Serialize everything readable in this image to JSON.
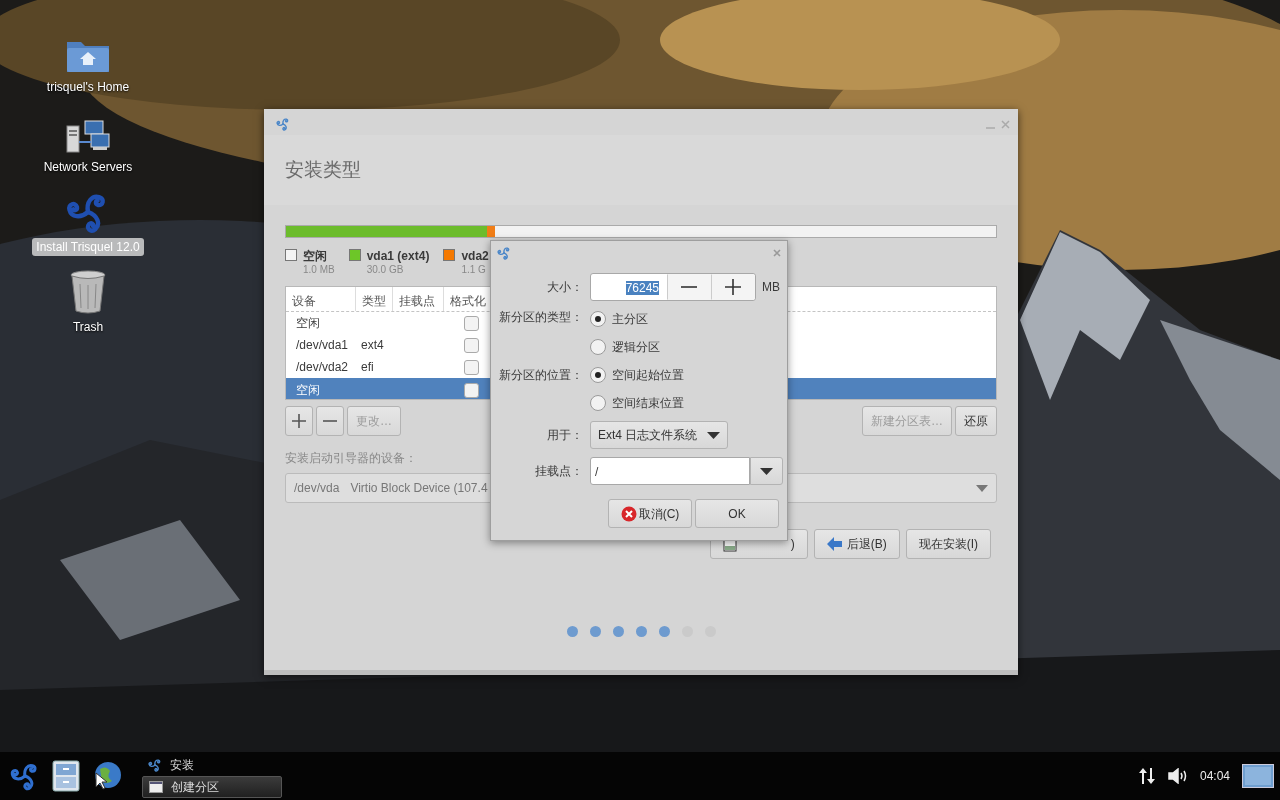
{
  "desktop_icons": [
    {
      "kind": "home",
      "label": "trisquel's Home",
      "selected": false
    },
    {
      "kind": "network",
      "label": "Network Servers",
      "selected": false
    },
    {
      "kind": "installer",
      "label": "Install Trisquel 12.0",
      "selected": true
    },
    {
      "kind": "trash",
      "label": "Trash",
      "selected": false
    }
  ],
  "installer": {
    "title": "安装类型",
    "partition_bar": [
      {
        "color": "#6cbc2c",
        "level": 0.283
      },
      {
        "color": "#f07d16",
        "level": 0.011
      },
      {
        "color": "#f2f2f2",
        "level": 0.706
      }
    ],
    "legend": [
      {
        "name": "空闲",
        "size": "1.0 MB",
        "color": "#f4f4f4"
      },
      {
        "name": "vda1 (ext4)",
        "size": "30.0 GB",
        "color": "#6dc628"
      },
      {
        "name": "vda2",
        "size": "1.1 G",
        "color": "#f57900"
      }
    ],
    "table": {
      "columns": [
        "设备",
        "类型",
        "挂载点",
        "格式化"
      ],
      "rows": [
        {
          "device": "空闲",
          "format": false,
          "selected": false
        },
        {
          "device": "/dev/vda1",
          "type": "ext4",
          "format": false,
          "selected": false
        },
        {
          "device": "/dev/vda2",
          "type": "efi",
          "format": false,
          "selected": false
        },
        {
          "device": "空闲",
          "format": false,
          "selected": true
        }
      ]
    },
    "tool_buttons": [
      {
        "kind": "add",
        "disabled": false
      },
      {
        "kind": "remove",
        "disabled": false
      },
      {
        "kind": "text",
        "label": "更改…",
        "disabled": true
      }
    ],
    "table_buttons": [
      {
        "label": "新建分区表…",
        "disabled": true
      },
      {
        "label": "还原",
        "disabled": false
      }
    ],
    "bootloader": {
      "label": "安装启动引导器的设备：",
      "device": "/dev/vda",
      "description": "Virtio Block Device (107.4"
    },
    "nav_buttons": [
      {
        "kind": "quit",
        "label": ")"
      },
      {
        "kind": "back",
        "label": "后退(B)"
      },
      {
        "kind": "plain",
        "label": "现在安装(I)"
      }
    ],
    "steps": [
      {
        "done": true
      },
      {
        "done": true
      },
      {
        "done": true
      },
      {
        "done": true
      },
      {
        "done": true
      },
      {
        "done": false
      },
      {
        "done": false
      }
    ]
  },
  "dialog": {
    "size": {
      "label": "大小：",
      "value": "76245",
      "text_selected": true,
      "unit": "MB"
    },
    "type": {
      "label": "新分区的类型：",
      "options": [
        {
          "label": "主分区",
          "selected": true
        },
        {
          "label": "逻辑分区",
          "selected": false
        }
      ]
    },
    "location": {
      "label": "新分区的位置：",
      "options": [
        {
          "label": "空间起始位置",
          "selected": true
        },
        {
          "label": "空间结束位置",
          "selected": false
        }
      ]
    },
    "use_as": {
      "label": "用于：",
      "value": "Ext4 日志文件系统"
    },
    "mount_point": {
      "label": "挂载点：",
      "value": "/"
    },
    "buttons": [
      {
        "kind": "cancel",
        "label": "取消(C)"
      },
      {
        "kind": "ok",
        "label": "OK"
      }
    ]
  },
  "taskbar": {
    "tasks": [
      {
        "label": "安装",
        "selected": false
      },
      {
        "label": "创建分区",
        "selected": true
      }
    ],
    "clock": "04:04"
  }
}
